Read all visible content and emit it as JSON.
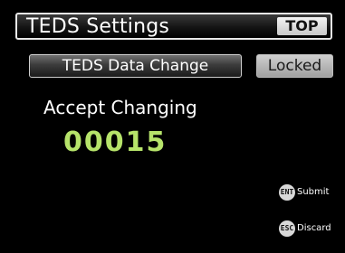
{
  "header": {
    "title": "TEDS Settings",
    "top_label": "TOP"
  },
  "actions": {
    "change_label": "TEDS Data Change",
    "status_label": "Locked"
  },
  "field": {
    "label": "Accept Changing",
    "value": "00015"
  },
  "keys": {
    "submit": {
      "key": "ENT",
      "label": "Submit"
    },
    "discard": {
      "key": "ESC",
      "label": "Discard"
    }
  },
  "colors": {
    "value_accent": "#b6e36a",
    "background": "#000000"
  }
}
